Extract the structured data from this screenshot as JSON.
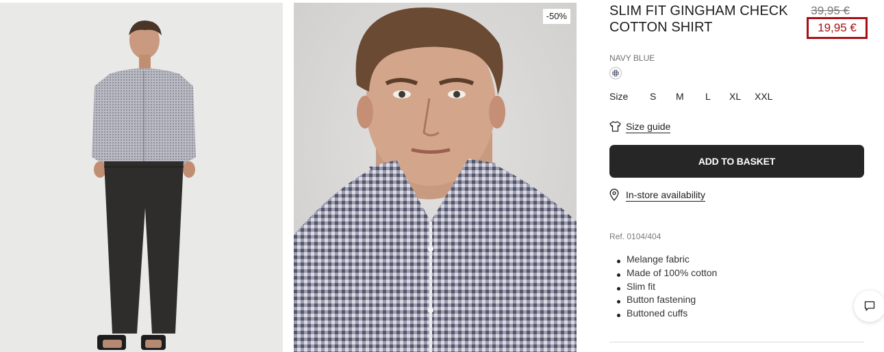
{
  "gallery": {
    "image_1": {
      "alt": "full-body model"
    },
    "image_2": {
      "alt": "close-up model",
      "badge": "-50%"
    }
  },
  "product": {
    "title": "SLIM FIT GINGHAM CHECK COTTON SHIRT",
    "old_price": "39,95 €",
    "current_price": "19,95 €",
    "price_highlight_color": "#a80e12",
    "color": {
      "label": "NAVY BLUE",
      "swatch_icon": "gingham-swatch"
    },
    "size": {
      "label": "Size",
      "options": [
        "S",
        "M",
        "L",
        "XL",
        "XXL"
      ]
    },
    "size_guide_label": "Size guide",
    "size_guide_icon": "tshirt-icon",
    "add_to_basket_label": "ADD TO BASKET",
    "store_availability_label": "In-store availability",
    "store_icon": "location-pin-icon",
    "reference": "Ref. 0104/404",
    "features": [
      "Melange fabric",
      "Made of 100% cotton",
      "Slim fit",
      "Button fastening",
      "Buttoned cuffs"
    ]
  },
  "chat": {
    "icon": "chat-bubble-icon"
  },
  "colors": {
    "button_bg": "#262626",
    "text": "#1c1c1c",
    "muted": "#707070"
  }
}
